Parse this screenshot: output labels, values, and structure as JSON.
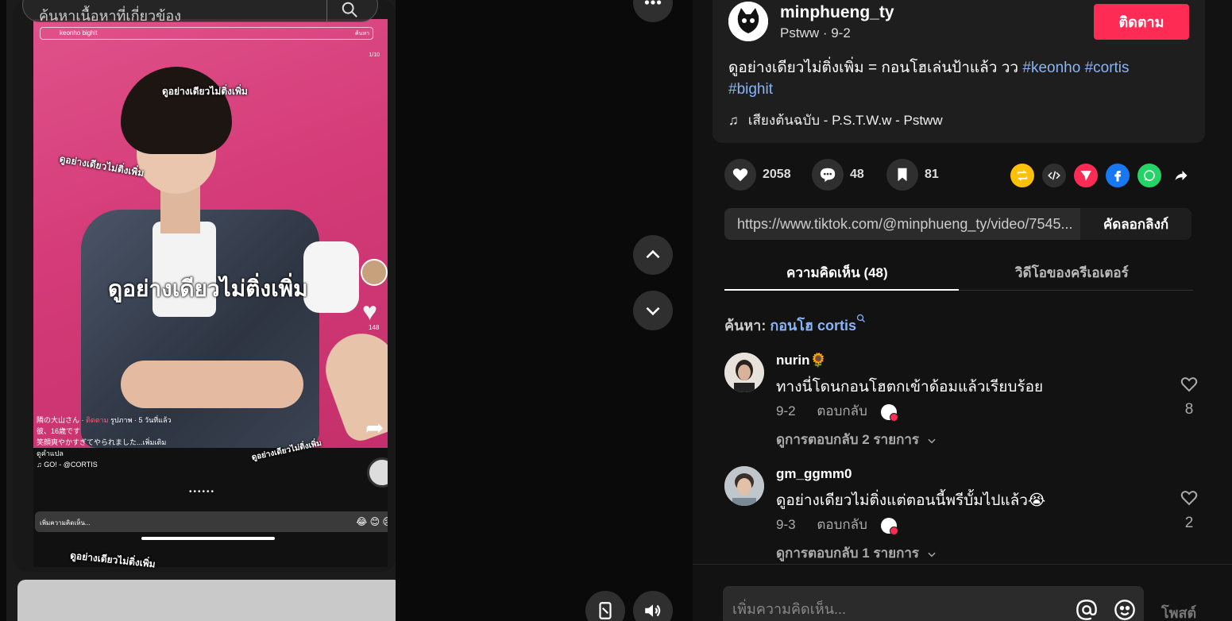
{
  "video": {
    "search_placeholder": "ค้นหาเนื้อหาที่เกี่ยวข้อง",
    "inner_search_text": "keonho bighit",
    "inner_search_button": "ค้นหา",
    "inner_counter": "1/10",
    "overlay_big": "ดูอย่างเดียวไม่ติ่งเพิ่ม",
    "overlay_small": "ดูอย่างเดียวไม่ติ่งเพิ่ม",
    "inner_like_count": "148",
    "inner_caption_user": "隣の大山さん",
    "inner_caption_follow": "ติดตาม",
    "inner_caption_meta": "รูปภาพ · 5 วันที่แล้ว",
    "inner_caption_line1": "彼、16歳です",
    "inner_caption_line2": "笑顔爽やかすぎてやられました...เพิ่มเติม",
    "inner_caption_line3": "ดูคำแปล",
    "inner_caption_music": "♫ GO! - @CORTIS",
    "inner_comment_placeholder": "เพิ่มความคิดเห็น...",
    "inner_emojis": "😂 😊 😢"
  },
  "author": {
    "username": "minphueng_ty",
    "subtitle": "Pstww · 9-2",
    "follow_label": "ติดตาม"
  },
  "description": {
    "text": "ดูอย่างเดียวไม่ติ่งเพิ่ม = กอนโฮเล่นป้าแล้ว วว ",
    "tags": [
      "#keonho",
      "#cortis",
      "#bighit"
    ]
  },
  "music": {
    "label": "เสียงต้นฉบับ - P.S.T.W.w - Pstww"
  },
  "stats": {
    "likes": "2058",
    "comments": "48",
    "saves": "81"
  },
  "link": {
    "url": "https://www.tiktok.com/@minphueng_ty/video/7545...",
    "copy_label": "คัดลอกลิงก์"
  },
  "tabs": [
    {
      "label": "ความคิดเห็น (48)",
      "active": true
    },
    {
      "label": "วิดีโอของครีเอเตอร์",
      "active": false
    }
  ],
  "search_hint": {
    "prefix": "ค้นหา:",
    "keyword": "กอนโฮ cortis"
  },
  "comments": [
    {
      "user": "nurin🌻",
      "text": "ทางนี่โดนกอนโฮตกเข้าด้อมแล้วเรียบร้อย",
      "date": "9-2",
      "reply_label": "ตอบกลับ",
      "view_replies": "ดูการตอบกลับ 2 รายการ",
      "likes": "8"
    },
    {
      "user": "gm_ggmm0",
      "text": "ดูอย่างเดียวไม่ติ่งแต่ตอนนี้พรีบั้มไปแล้ว😭",
      "date": "9-3",
      "reply_label": "ตอบกลับ",
      "view_replies": "ดูการตอบกลับ 1 รายการ",
      "likes": "2"
    }
  ],
  "input": {
    "placeholder": "เพิ่มความคิดเห็น...",
    "post_label": "โพสต์"
  },
  "colors": {
    "accent": "#fe2c55",
    "link": "#8ab4f8",
    "background": "#121212"
  }
}
